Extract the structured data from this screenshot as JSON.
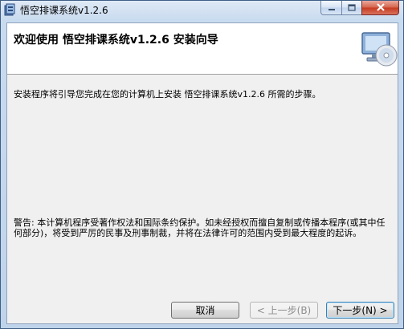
{
  "window": {
    "title": "悟空排课系统v1.2.6",
    "icons": {
      "app": "installer-app-icon",
      "minimize": "minimize-icon",
      "maximize": "maximize-icon",
      "close": "close-icon"
    }
  },
  "banner": {
    "title": "欢迎使用 悟空排课系统v1.2.6 安装向导",
    "icon": "computer-cd-icon"
  },
  "content": {
    "description": "安装程序将引导您完成在您的计算机上安装 悟空排课系统v1.2.6 所需的步骤。",
    "warning": "警告: 本计算机程序受著作权法和国际条约保护。如未经授权而擅自复制或传播本程序(或其中任何部分)，将受到严厉的民事及刑事制裁，并将在法律许可的范围内受到最大程度的起诉。"
  },
  "buttons": {
    "cancel": "取消",
    "back": "< 上一步(B)",
    "next": "下一步(N) >"
  },
  "colors": {
    "frame": "#c9dbef",
    "close_button": "#c5391f",
    "client": "#f0f0f0",
    "banner": "#ffffff",
    "disabled_text": "#8d8d8d"
  }
}
